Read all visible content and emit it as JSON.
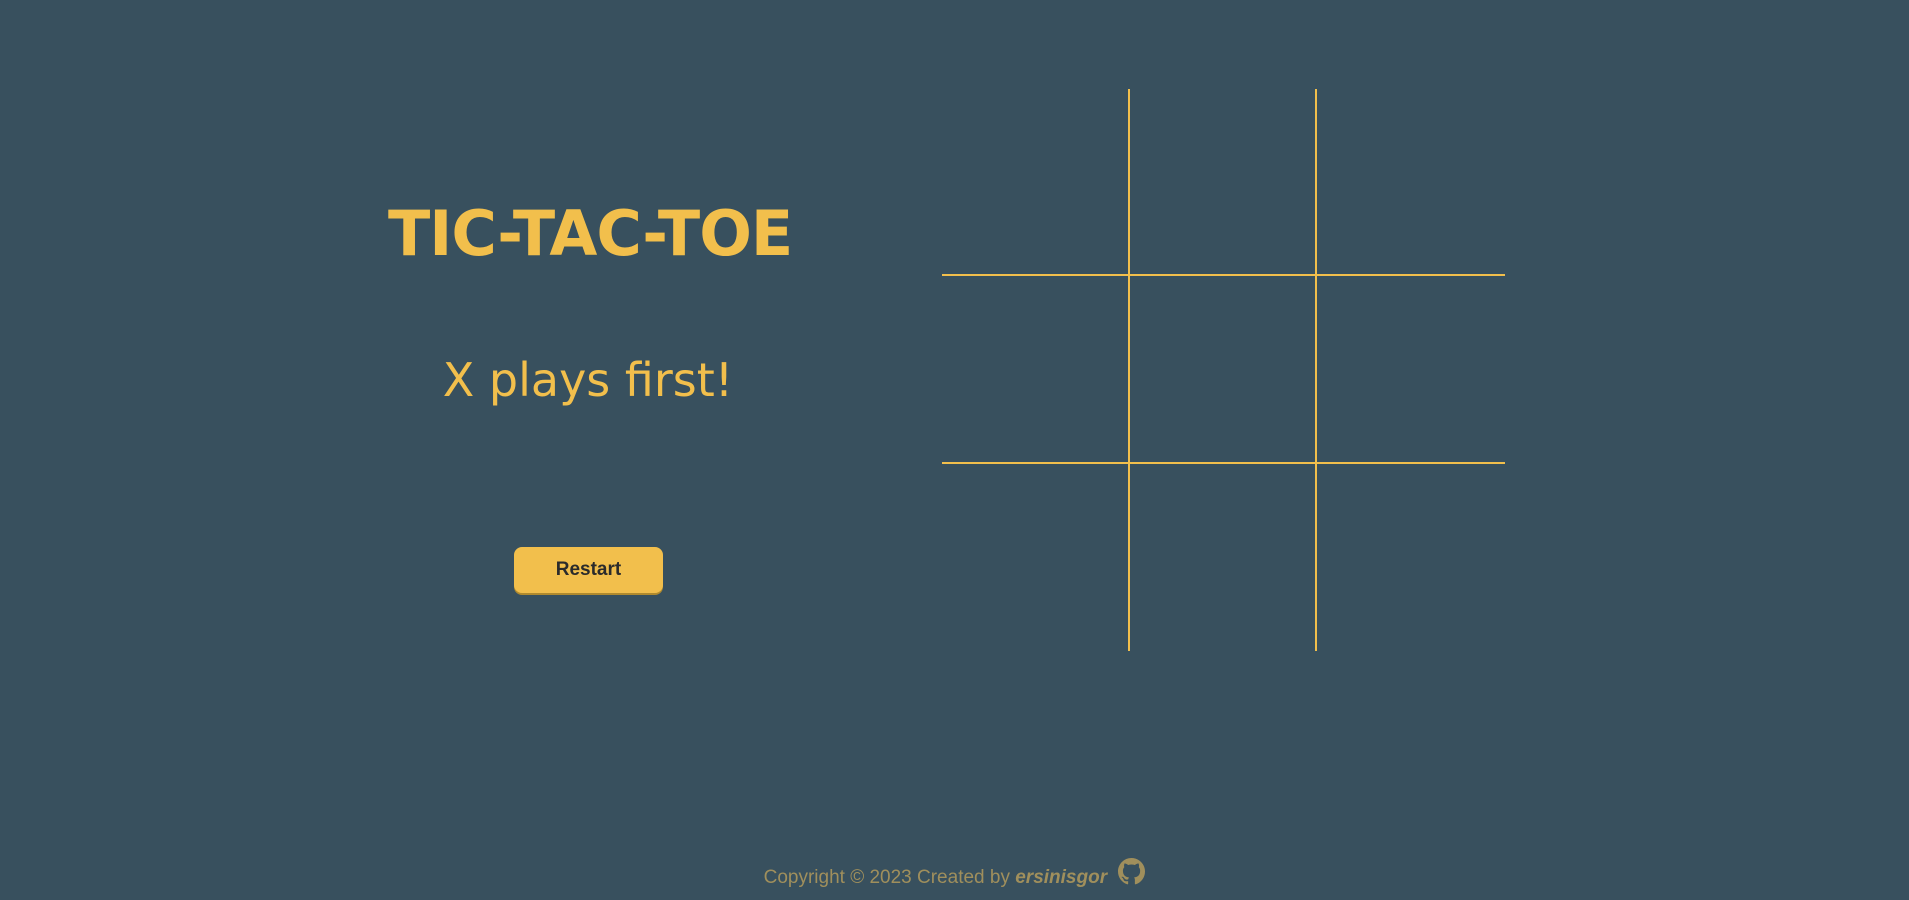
{
  "game": {
    "title": "TIC-TAC-TOE",
    "status": "X plays first!",
    "restart_label": "Restart",
    "board": [
      [
        "",
        "",
        ""
      ],
      [
        "",
        "",
        ""
      ],
      [
        "",
        "",
        ""
      ]
    ]
  },
  "footer": {
    "prefix": "Copyright © 2023 Created by ",
    "author": "ersinisgor",
    "icon": "github-icon"
  },
  "colors": {
    "background": "#38505e",
    "accent": "#f2bf4c",
    "footer_text": "#a08f5c"
  }
}
